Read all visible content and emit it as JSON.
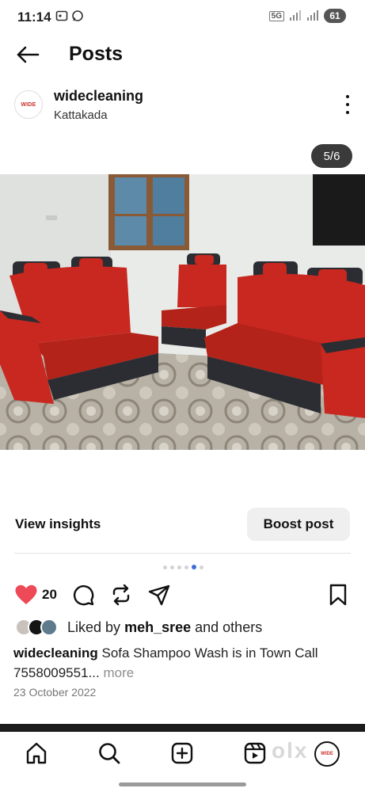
{
  "status_bar": {
    "time": "11:14",
    "network": "5G",
    "battery": "61"
  },
  "header": {
    "title": "Posts"
  },
  "post": {
    "username": "widecleaning",
    "location": "Kattakada",
    "avatar_logo_text": "WIDE",
    "image_counter": "5/6",
    "carousel": {
      "total": 6,
      "current": 5
    },
    "view_insights_label": "View insights",
    "boost_label": "Boost post",
    "like_count": "20",
    "liked_by_prefix": "Liked by",
    "liked_by_user": "meh_sree",
    "liked_by_suffix": "and others",
    "caption_user": "widecleaning",
    "caption_text": "Sofa Shampoo Wash is in Town Call 7558009551...",
    "caption_more": "more",
    "date": "23 October 2022"
  },
  "bottom_nav": {
    "items": [
      "home-icon",
      "search-icon",
      "create-icon",
      "reels-icon",
      "profile-avatar"
    ],
    "watermark": "olx"
  },
  "colors": {
    "like_red": "#ed4956",
    "active_dot": "#3b6fd6",
    "sofa_red": "#c8281f",
    "sofa_dark": "#2b2d33"
  }
}
